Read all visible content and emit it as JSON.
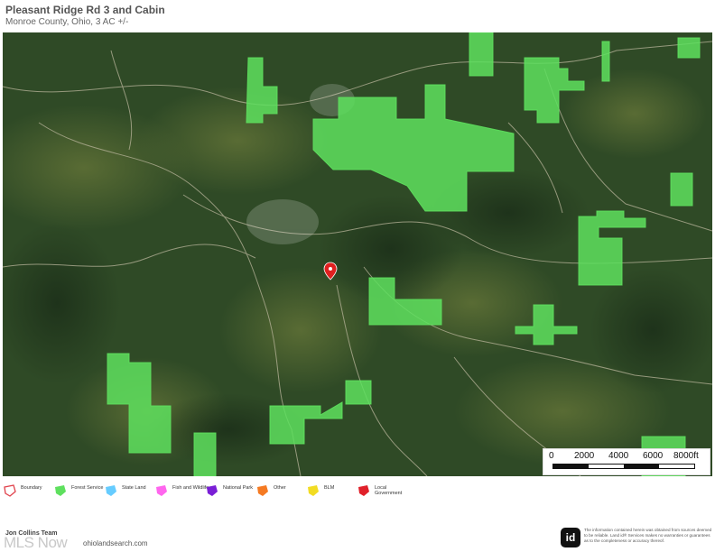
{
  "header": {
    "title": "Pleasant Ridge Rd 3 and Cabin",
    "subtitle": "Monroe County, Ohio, 3 AC +/-"
  },
  "map": {
    "type": "satellite",
    "marker_color": "#e02020",
    "forest_color": "#5ee05e"
  },
  "scale_bar": {
    "labels": [
      "0",
      "2000",
      "4000",
      "6000",
      "8000ft"
    ]
  },
  "legend": [
    {
      "label": "Boundary",
      "color": "#e0404a",
      "icon": "boundary-outline-icon"
    },
    {
      "label": "Forest Service",
      "color": "#5ee05e",
      "icon": "forest-service-icon"
    },
    {
      "label": "State Land",
      "color": "#66ccff",
      "icon": "state-land-icon"
    },
    {
      "label": "Fish and Wildlife",
      "color": "#ff66ee",
      "icon": "fish-wildlife-icon"
    },
    {
      "label": "National Park",
      "color": "#7a1fd6",
      "icon": "national-park-icon"
    },
    {
      "label": "Other",
      "color": "#f57a22",
      "icon": "other-icon"
    },
    {
      "label": "BLM",
      "color": "#f2dc23",
      "icon": "blm-icon"
    },
    {
      "label": "Local Government",
      "color": "#e0202a",
      "icon": "local-government-icon"
    }
  ],
  "agent": {
    "name": "Jon Collins Team",
    "website": "ohiolandsearch.com",
    "mls_logo": "MLS Now"
  },
  "disclaimer": {
    "logo": "id",
    "text": "The information contained herein was obtained from sources deemed to be reliable. Land id® Services makes no warranties or guarantees as to the completeness or accuracy thereof."
  }
}
